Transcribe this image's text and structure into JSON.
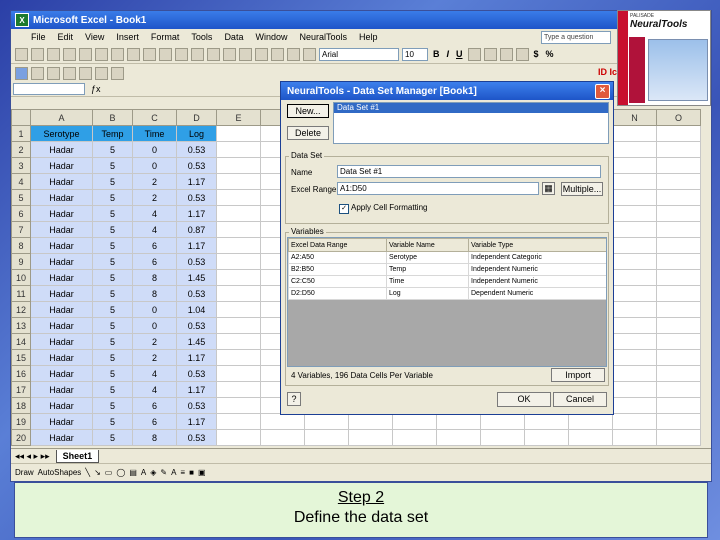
{
  "window": {
    "title": "Microsoft Excel - Book1",
    "app_icon": "X"
  },
  "menu": [
    "File",
    "Edit",
    "View",
    "Insert",
    "Format",
    "Tools",
    "Data",
    "Window",
    "NeuralTools",
    "Help"
  ],
  "help_box": {
    "placeholder": "Type a question"
  },
  "toolbar": {
    "font": "Arial",
    "size": "10",
    "bold": "B",
    "italic": "I",
    "underline": "U",
    "currency": "$",
    "percent": "%"
  },
  "neuraltools_toolbar": {
    "icons": "ID Ic"
  },
  "neuraltools_box": {
    "brand": "PALISADE",
    "title": "NeuralTools"
  },
  "sheet": {
    "columns": [
      "A",
      "B",
      "C",
      "D",
      "E",
      "F",
      "G",
      "H",
      "I",
      "J",
      "K",
      "L",
      "M",
      "N",
      "O"
    ],
    "headers": [
      "Serotype",
      "Temp",
      "Time",
      "Log"
    ],
    "rows": [
      [
        "Hadar",
        "5",
        "0",
        "0.53"
      ],
      [
        "Hadar",
        "5",
        "0",
        "0.53"
      ],
      [
        "Hadar",
        "5",
        "2",
        "1.17"
      ],
      [
        "Hadar",
        "5",
        "2",
        "0.53"
      ],
      [
        "Hadar",
        "5",
        "4",
        "1.17"
      ],
      [
        "Hadar",
        "5",
        "4",
        "0.87"
      ],
      [
        "Hadar",
        "5",
        "6",
        "1.17"
      ],
      [
        "Hadar",
        "5",
        "6",
        "0.53"
      ],
      [
        "Hadar",
        "5",
        "8",
        "1.45"
      ],
      [
        "Hadar",
        "5",
        "8",
        "0.53"
      ],
      [
        "Hadar",
        "5",
        "0",
        "1.04"
      ],
      [
        "Hadar",
        "5",
        "0",
        "0.53"
      ],
      [
        "Hadar",
        "5",
        "2",
        "1.45"
      ],
      [
        "Hadar",
        "5",
        "2",
        "1.17"
      ],
      [
        "Hadar",
        "5",
        "4",
        "0.53"
      ],
      [
        "Hadar",
        "5",
        "4",
        "1.17"
      ],
      [
        "Hadar",
        "5",
        "6",
        "0.53"
      ],
      [
        "Hadar",
        "5",
        "6",
        "1.17"
      ],
      [
        "Hadar",
        "5",
        "8",
        "0.53"
      ]
    ],
    "tab": "Sheet1"
  },
  "drawbar": {
    "draw": "Draw",
    "autoshapes": "AutoShapes"
  },
  "dialog": {
    "title": "NeuralTools - Data Set Manager [Book1]",
    "new_button": "New...",
    "delete_button": "Delete",
    "selected_dataset": "Data Set #1",
    "dataset_group": "Data Set",
    "name_label": "Name",
    "name_value": "Data Set #1",
    "range_label": "Excel Range",
    "range_value": "A1:D50",
    "multiple_button": "Multiple...",
    "apply_label": "Apply Cell Formatting",
    "variables_group": "Variables",
    "var_columns": [
      "Excel Data Range",
      "Variable Name",
      "Variable Type"
    ],
    "var_rows": [
      [
        "A2:A50",
        "Serotype",
        "Independent Categoric"
      ],
      [
        "B2:B50",
        "Temp",
        "Independent Numeric"
      ],
      [
        "C2:C50",
        "Time",
        "Independent Numeric"
      ],
      [
        "D2:D50",
        "Log",
        "Dependent Numeric"
      ]
    ],
    "summary": "4 Variables, 196 Data Cells Per Variable",
    "import_button": "Import",
    "ok_button": "OK",
    "cancel_button": "Cancel",
    "help_icon": "?"
  },
  "caption": {
    "line1": "Step 2",
    "line2": "Define the data set"
  }
}
